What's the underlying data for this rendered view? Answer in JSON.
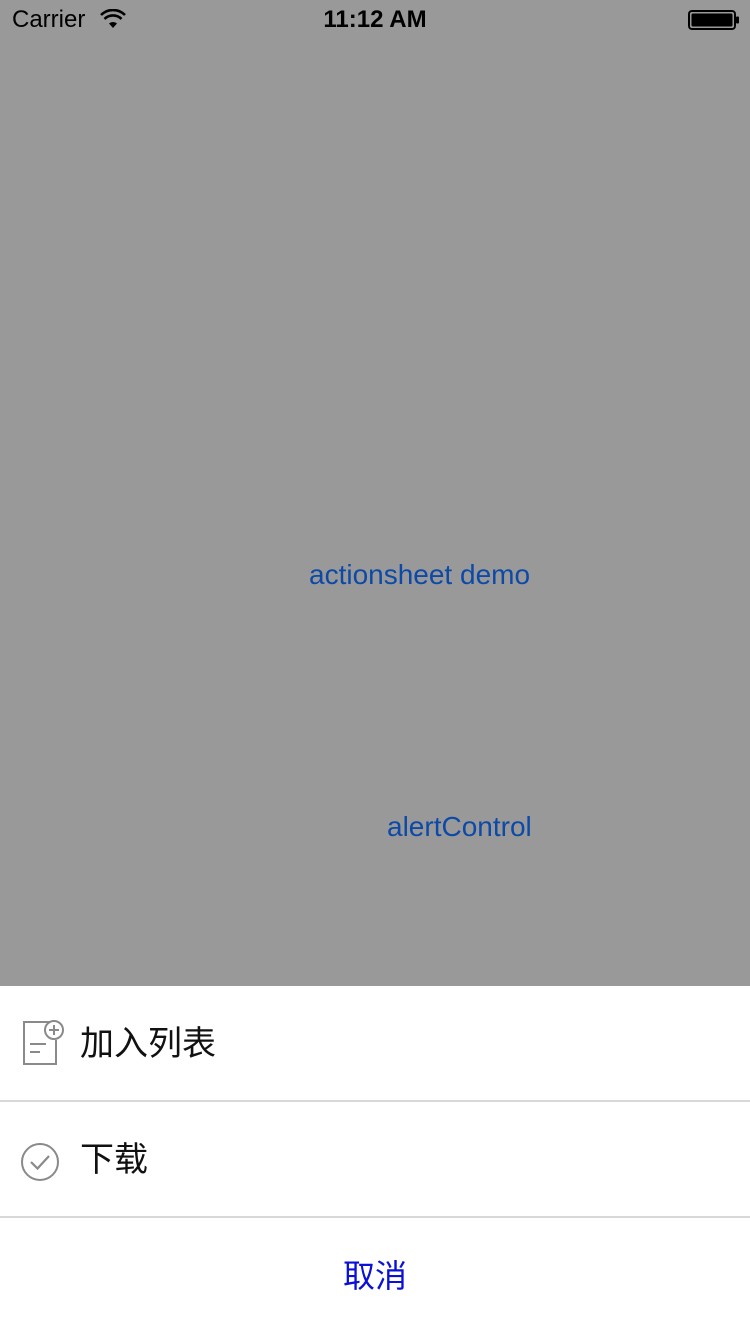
{
  "status_bar": {
    "carrier": "Carrier",
    "time": "11:12 AM",
    "wifi_icon": "wifi-icon",
    "battery_icon": "battery-icon"
  },
  "main": {
    "actionsheet_button": "actionsheet demo",
    "alert_button": "alertControl"
  },
  "action_sheet": {
    "items": [
      {
        "label": "加入列表",
        "icon": "add-to-list-icon"
      },
      {
        "label": "下载",
        "icon": "checkmark-circle-icon"
      }
    ],
    "cancel_label": "取消"
  },
  "colors": {
    "background_dim": "#999999",
    "link": "#0d4aa8",
    "cancel": "#0a10d6",
    "sheet": "#ffffff"
  }
}
